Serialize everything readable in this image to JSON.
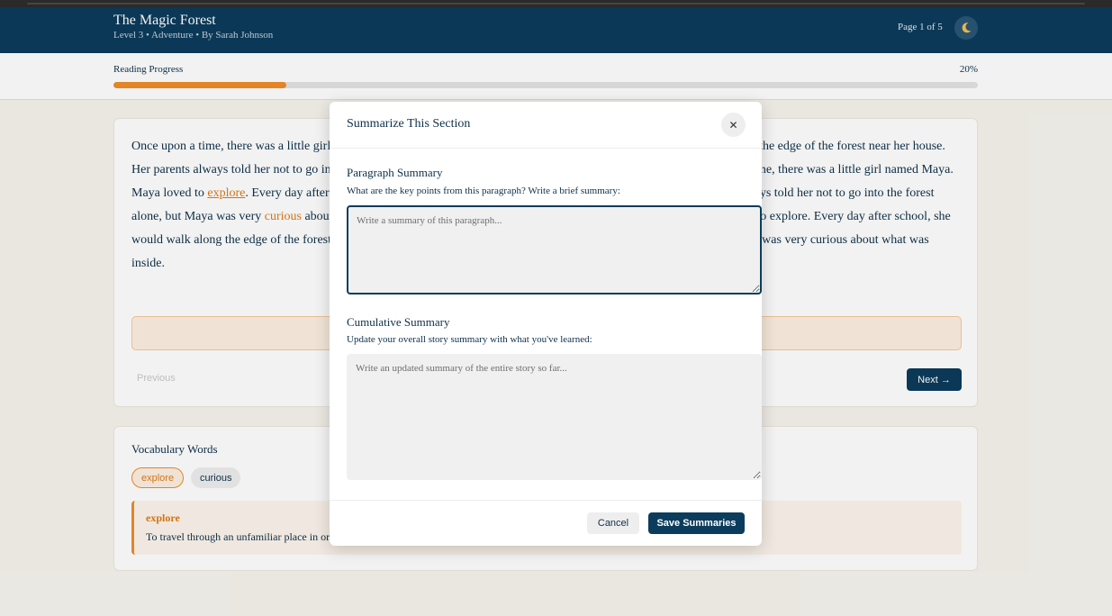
{
  "header": {
    "title": "The Magic Forest",
    "subtitle": "Level 3 • Adventure • By Sarah Johnson",
    "page_indicator": "Page 1 of 5",
    "theme_icon": "moon-icon"
  },
  "progress": {
    "label": "Reading Progress",
    "percent_text": "20%",
    "value": 0.2,
    "color": "#f08c2a"
  },
  "reading": {
    "segments": [
      "Once upon a time, there was a little girl named Maya. Maya loved to explore. Every day after school, she would walk along the edge of the forest near her house. Her parents always told her not to go into the forest alone, but Maya was very curious about what was inside.Once upon a time, there was a little girl named Maya. Maya loved to ",
      "explore",
      ". Every day after school, she would walk along the edge of the forest near her house. Her parents always told her not to go into the forest alone, but Maya was very ",
      "curious",
      " about what was inside.Once upon a time, there was a little girl named Maya. Maya loved to explore. Every day after school, she would walk along the edge of the forest near her house. Her parents always told her not to go into the forest alone, but Maya was very curious about what was inside."
    ],
    "prev_label": "Previous",
    "next_label": "Next →"
  },
  "vocabulary": {
    "heading": "Vocabulary Words",
    "words": [
      "explore",
      "curious"
    ],
    "selected": {
      "word": "explore",
      "definition": "To travel through an unfamiliar place in order to learn about it."
    }
  },
  "modal": {
    "title": "Summarize This Section",
    "close_icon": "close-icon",
    "paragraph_label": "Paragraph Summary",
    "paragraph_help": "What are the key points from this paragraph? Write a brief summary:",
    "paragraph_placeholder": "Write a summary of this paragraph...",
    "paragraph_value": "",
    "cumulative_label": "Cumulative Summary",
    "cumulative_help": "Update your overall story summary with what you've learned:",
    "cumulative_placeholder": "Write an updated summary of the entire story so far...",
    "cumulative_value": "",
    "cancel_label": "Cancel",
    "save_label": "Save Summaries"
  }
}
